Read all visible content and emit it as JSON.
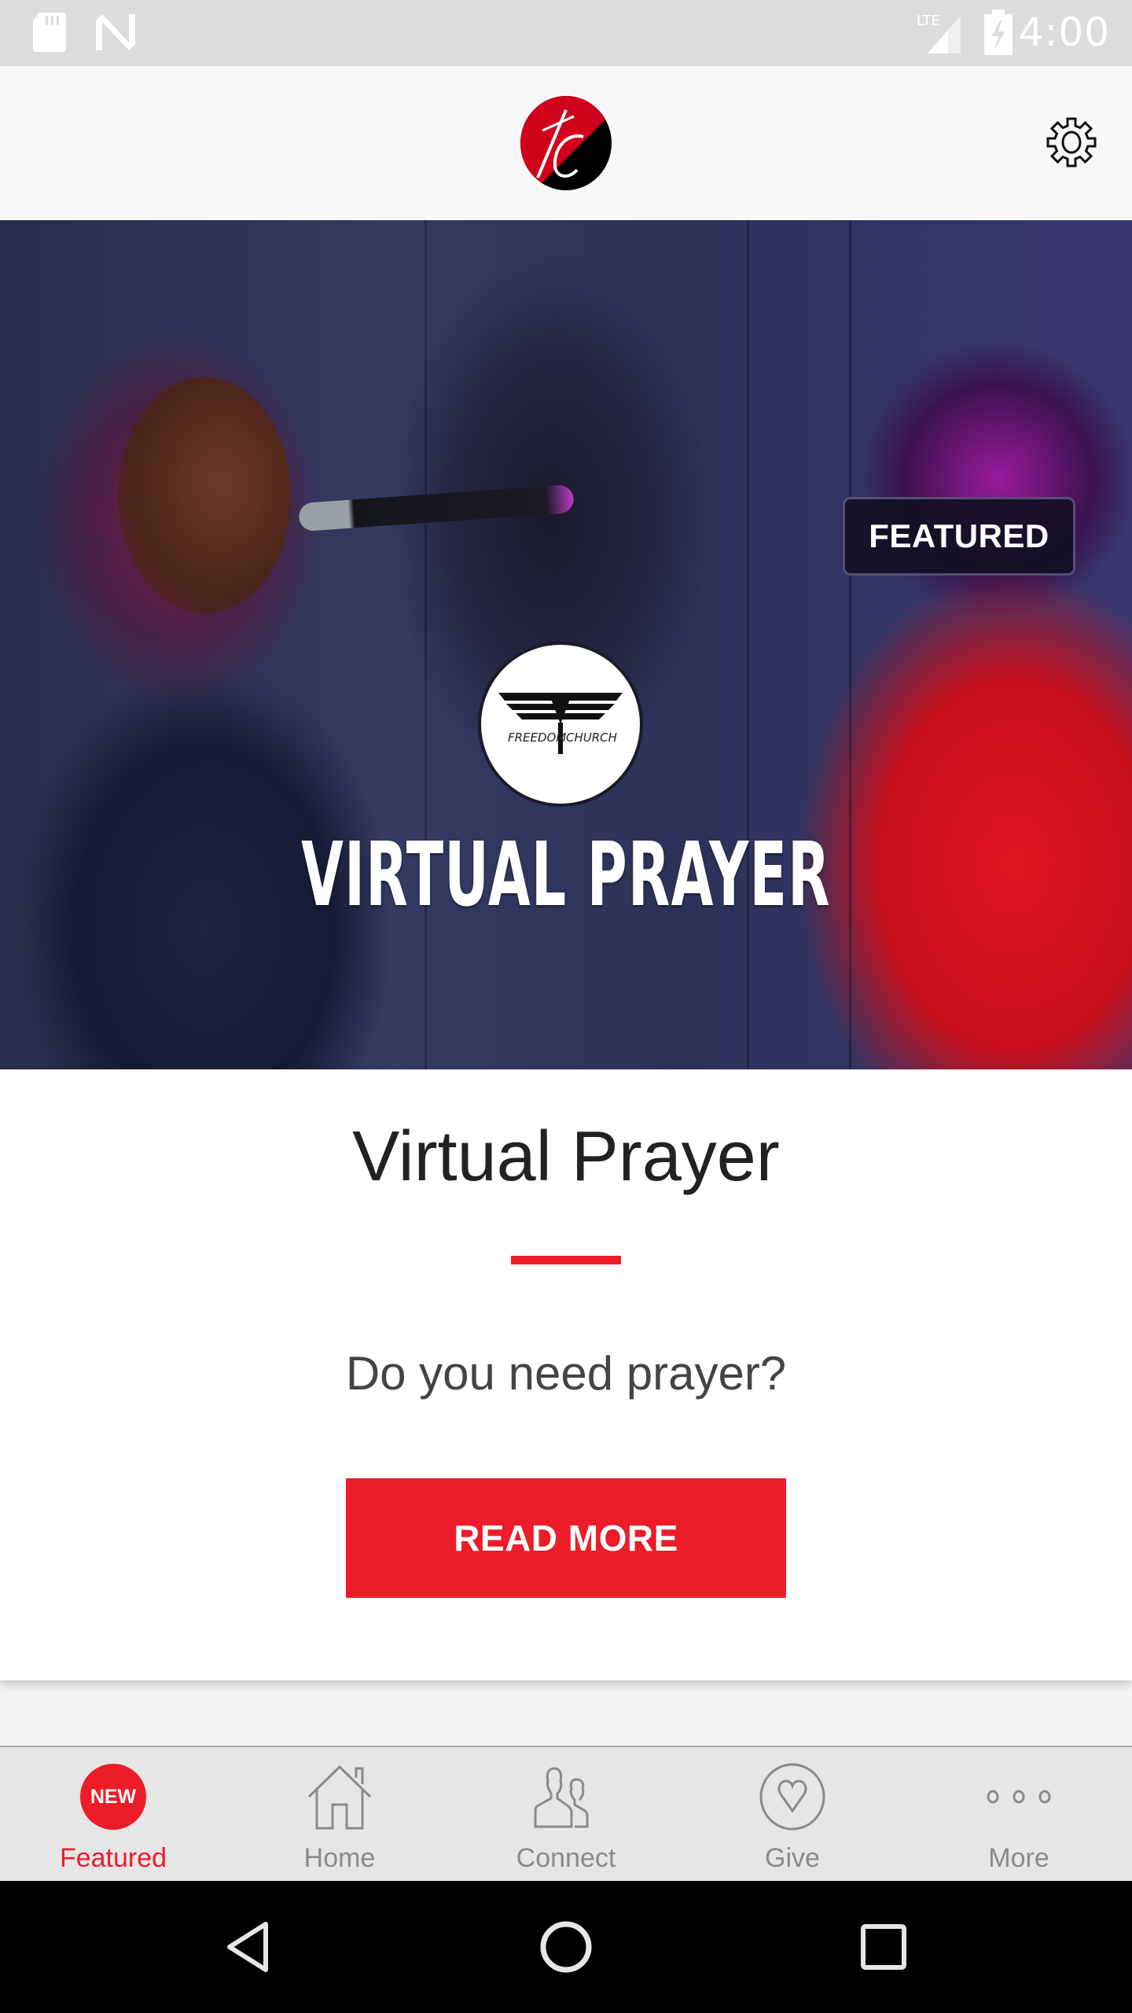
{
  "status_bar": {
    "time": "4:00",
    "network": "LTE",
    "icons": [
      "sd-card-icon",
      "n-notification-icon",
      "lte-signal-icon",
      "battery-charging-icon"
    ]
  },
  "header": {
    "logo_alt": "FC",
    "brand_colors": {
      "red": "#d0021b",
      "black": "#000000"
    },
    "settings_icon": "gear-icon"
  },
  "hero": {
    "badge": "FEATURED",
    "image_title": "VIRTUAL PRAYER",
    "emblem_text_left": "FREEDOM",
    "emblem_text_right": "CHURCH"
  },
  "card": {
    "title": "Virtual Prayer",
    "subtitle": "Do you need prayer?",
    "button_label": "READ MORE",
    "accent_color": "#ed1c29"
  },
  "tabs": [
    {
      "label": "Featured",
      "icon": "new-badge-icon",
      "badge": "NEW",
      "active": true
    },
    {
      "label": "Home",
      "icon": "home-icon",
      "active": false
    },
    {
      "label": "Connect",
      "icon": "people-icon",
      "active": false
    },
    {
      "label": "Give",
      "icon": "heart-circle-icon",
      "active": false
    },
    {
      "label": "More",
      "icon": "more-dots-icon",
      "active": false
    }
  ],
  "system_nav": {
    "buttons": [
      "back-icon",
      "home-circle-icon",
      "recents-icon"
    ]
  }
}
